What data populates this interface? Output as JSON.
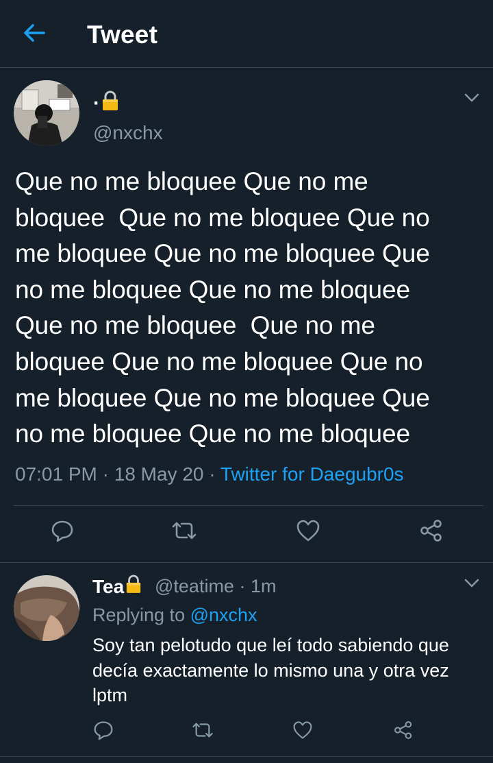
{
  "header": {
    "title": "Tweet",
    "back_icon": "arrow-left-icon",
    "accent_color": "#1da1f2"
  },
  "tweet": {
    "author": {
      "display_name": "·",
      "lock_icon": "lock-icon",
      "handle": "@nxchx"
    },
    "text": "Que no me bloquee Que no me\nbloquee  Que no me bloquee Que no\nme bloquee Que no me bloquee Que\nno me bloquee Que no me bloquee\nQue no me bloquee  Que no me\nbloquee Que no me bloquee Que no\nme bloquee Que no me bloquee Que\nno me bloquee Que no me bloquee",
    "time": "07:01 PM",
    "sep1": " · ",
    "date": "18 May 20",
    "sep2": " · ",
    "source": "Twitter for Daegubr0s",
    "actions": [
      "reply-icon",
      "retweet-icon",
      "like-icon",
      "share-icon"
    ]
  },
  "reply": {
    "author": {
      "display_name": "Tea",
      "lock_icon": "lock-icon",
      "handle": "@teatime",
      "sep": " · ",
      "time": "1m"
    },
    "replying_prefix": "Replying to ",
    "replying_to": "@nxchx",
    "text": "Soy tan pelotudo que leí todo sabiendo que\ndecía exactamente lo mismo una y otra vez\nlptm",
    "actions": [
      "reply-icon",
      "retweet-icon",
      "like-icon",
      "share-icon"
    ]
  },
  "colors": {
    "background": "#15202b",
    "secondary_text": "#8899a6",
    "divider": "#38444d",
    "link": "#1da1f2"
  }
}
